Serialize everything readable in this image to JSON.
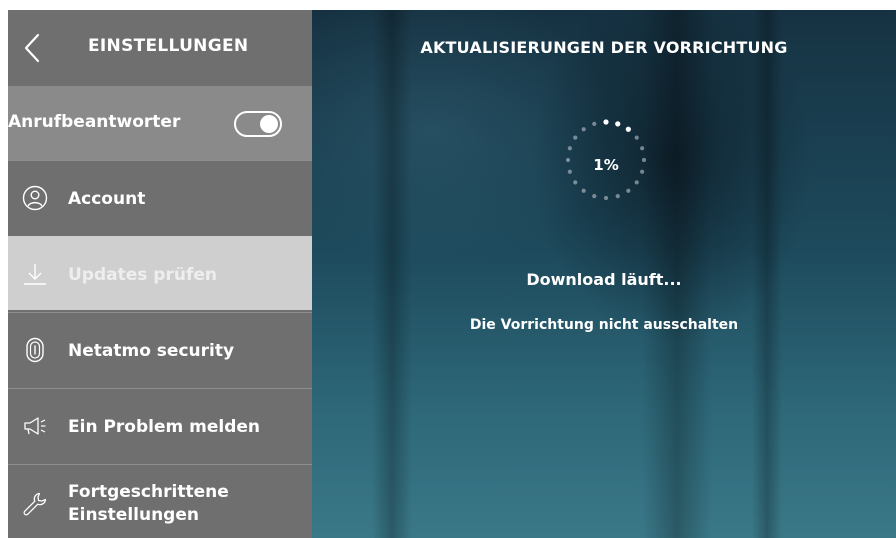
{
  "sidebar": {
    "header": {
      "back_icon": "chevron-left-icon",
      "title": "EINSTELLUNGEN"
    },
    "toggle_row": {
      "label": "Anrufbeantworter",
      "toggle_state": "on"
    },
    "items": [
      {
        "icon": "user-circle-icon",
        "label": "Account",
        "active": false
      },
      {
        "icon": "download-icon",
        "label": "Updates prüfen",
        "active": true
      },
      {
        "icon": "fingerprint-icon",
        "label": "Netatmo security",
        "active": false
      },
      {
        "icon": "megaphone-icon",
        "label": "Ein Problem melden",
        "active": false
      },
      {
        "icon": "wrench-icon",
        "label_line1": "Fortgeschrittene",
        "label_line2": "Einstellungen",
        "active": false
      }
    ]
  },
  "main": {
    "title": "AKTUALISIERUNGEN DER VORRICHTUNG",
    "progress": {
      "percent_label": "1%",
      "value": 0.01
    },
    "status": "Download läuft...",
    "hint": "Die Vorrichtung nicht ausschalten"
  },
  "colors": {
    "sidebar_bg": "#6f6f6f",
    "toggle_row_bg": "#8a8a8a",
    "active_item_bg": "#cfcfcf",
    "main_bg": "#1d4a5c"
  }
}
